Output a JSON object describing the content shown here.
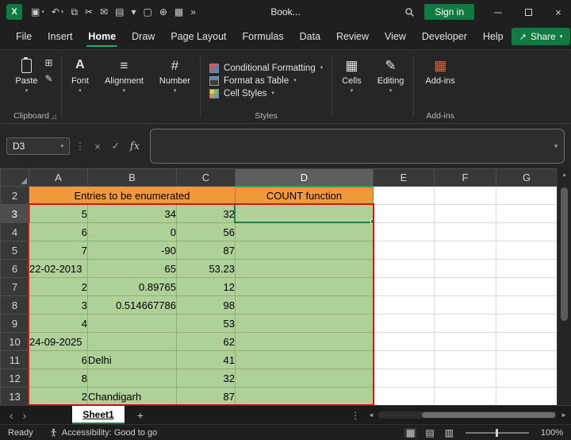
{
  "colors": {
    "accent_green": "#107C41",
    "banner_orange": "#F0983A",
    "cell_fill_green": "#AED197",
    "range_border_red": "#E01010"
  },
  "icons": {
    "chevron_down": "▾",
    "ellipsis_v": "⋮",
    "cancel": "×",
    "confirm": "✓",
    "share": "↗",
    "tab_prev": "‹",
    "tab_next": "›",
    "add_sheet": "+",
    "scroll_left": "◄",
    "scroll_right": "►",
    "scroll_up": "▴",
    "grid_view": "▦",
    "page_view": "▤",
    "break_view": "▥",
    "font_a": "A",
    "align": "≡",
    "number": "#",
    "cells": "▦",
    "editing": "✎",
    "addins": "▦",
    "launcher": "◿",
    "copy": "⊞",
    "format_painter": "✎"
  },
  "titlebar": {
    "title": "Book...",
    "sign_in_label": "Sign in",
    "window": {
      "minimize": "─",
      "close": "×"
    },
    "qat": [
      {
        "name": "save-icon",
        "glyph": "▣",
        "chevron": true
      },
      {
        "name": "undo-icon",
        "glyph": "↶",
        "chevron": true
      },
      {
        "name": "copy-icon",
        "glyph": "⧉"
      },
      {
        "name": "cut-icon",
        "glyph": "✂"
      },
      {
        "name": "mail-icon",
        "glyph": "✉"
      },
      {
        "name": "print-icon",
        "glyph": "▤"
      },
      {
        "name": "chevron-down-icon",
        "glyph": "▾"
      },
      {
        "name": "new-document-icon",
        "glyph": "▢"
      },
      {
        "name": "add-icon",
        "glyph": "⊕"
      },
      {
        "name": "table-icon",
        "glyph": "▦"
      },
      {
        "name": "more-icon",
        "glyph": "»"
      }
    ]
  },
  "menubar": {
    "tabs": [
      "File",
      "Insert",
      "Home",
      "Draw",
      "Page Layout",
      "Formulas",
      "Data",
      "Review",
      "View",
      "Developer",
      "Help"
    ],
    "active_tab": "Home",
    "share_label": "Share"
  },
  "ribbon": {
    "paste_label": "Paste",
    "font_label": "Font",
    "alignment_label": "Alignment",
    "number_label": "Number",
    "styles_buttons": [
      "Conditional Formatting",
      "Format as Table",
      "Cell Styles"
    ],
    "cells_label": "Cells",
    "editing_label": "Editing",
    "addins_label": "Add-ins",
    "group_labels": {
      "clipboard": "Clipboard",
      "styles": "Styles",
      "addins": "Add-ins"
    }
  },
  "formula_bar": {
    "name_box": "D3",
    "fx_label": "fx",
    "formula_value": ""
  },
  "grid": {
    "column_headers": [
      "A",
      "B",
      "C",
      "D",
      "E",
      "F",
      "G"
    ],
    "selected_column": "D",
    "selected_row": "3",
    "active_cell": "D3",
    "banner_row": {
      "number": "2",
      "left_text": "Entries to be enumerated",
      "right_text": "COUNT function"
    },
    "rows": [
      {
        "n": "3",
        "cells": [
          "5",
          "34",
          "32",
          ""
        ]
      },
      {
        "n": "4",
        "cells": [
          "6",
          "0",
          "56",
          ""
        ]
      },
      {
        "n": "5",
        "cells": [
          "7",
          "-90",
          "87",
          ""
        ]
      },
      {
        "n": "6",
        "cells": [
          "22-02-2013",
          "65",
          "53.23",
          ""
        ]
      },
      {
        "n": "7",
        "cells": [
          "2",
          "0.89765",
          "12",
          ""
        ]
      },
      {
        "n": "8",
        "cells": [
          "3",
          "0.514667786",
          "98",
          ""
        ]
      },
      {
        "n": "9",
        "cells": [
          "4",
          "",
          "53",
          ""
        ]
      },
      {
        "n": "10",
        "cells": [
          "24-09-2025",
          "",
          "62",
          ""
        ]
      },
      {
        "n": "11",
        "cells": [
          "6",
          "Delhi",
          "41",
          ""
        ]
      },
      {
        "n": "12",
        "cells": [
          "8",
          "",
          "32",
          ""
        ]
      },
      {
        "n": "13",
        "cells": [
          "2",
          "Chandigarh",
          "87",
          ""
        ]
      }
    ]
  },
  "sheet_bar": {
    "tabs": [
      "Sheet1"
    ],
    "active_tab": "Sheet1"
  },
  "status_bar": {
    "mode": "Ready",
    "accessibility": "Accessibility: Good to go",
    "zoom": "100%"
  }
}
